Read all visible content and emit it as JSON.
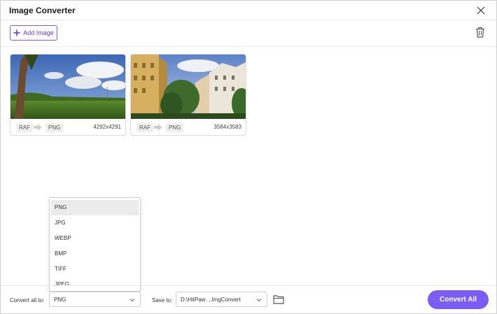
{
  "window": {
    "title": "Image Converter"
  },
  "toolbar": {
    "add_image_label": "Add Image"
  },
  "images": [
    {
      "source_format": "RAF",
      "target_format": "PNG",
      "dimensions": "4292x4291"
    },
    {
      "source_format": "RAF",
      "target_format": "PNG",
      "dimensions": "3584x3583"
    }
  ],
  "format_dropdown": {
    "options": [
      "PNG",
      "JPG",
      "WEBP",
      "BMP",
      "TIFF",
      "JPEG"
    ],
    "selected": "PNG"
  },
  "footer": {
    "convert_all_label": "Convert all to:",
    "convert_all_value": "PNG",
    "save_to_label": "Save to:",
    "save_to_value": "D:\\HitPaw ...ImgConvert",
    "convert_button_label": "Convert All"
  },
  "colors": {
    "accent": "#7b5cf5",
    "selected_option_bg": "#ebebeb"
  }
}
